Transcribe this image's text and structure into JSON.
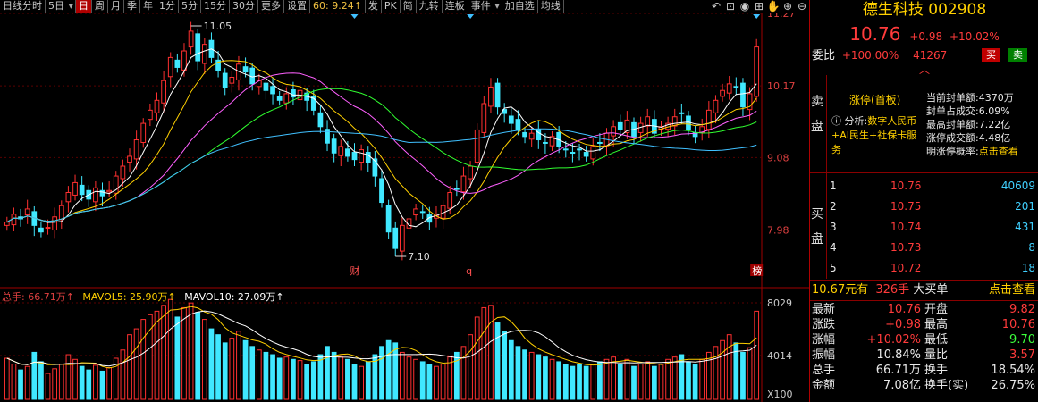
{
  "toolbar": {
    "items": [
      {
        "label": "日线分时",
        "dd": false
      },
      {
        "label": "5日",
        "dd": true
      },
      {
        "label": "日",
        "active": true
      },
      {
        "label": "周"
      },
      {
        "label": "月"
      },
      {
        "label": "季"
      },
      {
        "label": "年"
      },
      {
        "label": "1分"
      },
      {
        "label": "5分"
      },
      {
        "label": "15分"
      },
      {
        "label": "30分"
      },
      {
        "label": "更多"
      },
      {
        "label": "设置"
      },
      {
        "label": "60: 9.24↑",
        "hl": true
      },
      {
        "label": "发"
      },
      {
        "label": "PK"
      },
      {
        "label": "简"
      },
      {
        "label": "九转"
      },
      {
        "label": "连板"
      },
      {
        "label": "事件",
        "dd": true
      },
      {
        "label": "加自选"
      },
      {
        "label": "均线"
      }
    ],
    "icons": [
      "undo-icon",
      "lock-icon",
      "eye-icon",
      "bag-icon",
      "hand-icon",
      "zoom-in-icon",
      "zoom-out-icon"
    ]
  },
  "stock": {
    "name": "德生科技",
    "code": "002908",
    "price": "10.76",
    "change": "+0.98",
    "pct": "+10.02%",
    "weibi_label": "委比",
    "weibi": "+100.00%",
    "weicha": "41267",
    "buy_btn": "买",
    "sell_btn": "卖",
    "sell_side_label": "卖盘",
    "buy_side_label": "买盘"
  },
  "limit": {
    "title": "涨停(首板)",
    "analysis_label": "分析:",
    "analysis_text": "数字人民币+AI民生+社保卡服务",
    "stats": [
      {
        "k": "当前封单额:",
        "v": "4370万"
      },
      {
        "k": "封单占成交:",
        "v": "6.09%"
      },
      {
        "k": "最高封单额:",
        "v": "7.22亿"
      },
      {
        "k": "涨停成交额:",
        "v": "4.48亿"
      },
      {
        "k": "明涨停概率:",
        "v": "点击查看"
      }
    ]
  },
  "orderbook": {
    "bids": [
      {
        "lvl": "1",
        "price": "10.76",
        "vol": "40609"
      },
      {
        "lvl": "2",
        "price": "10.75",
        "vol": "201"
      },
      {
        "lvl": "3",
        "price": "10.74",
        "vol": "431"
      },
      {
        "lvl": "4",
        "price": "10.73",
        "vol": "8"
      },
      {
        "lvl": "5",
        "price": "10.72",
        "vol": "18"
      }
    ]
  },
  "bigbuy": {
    "price": "10.67元有",
    "vol": "326手",
    "label": "大买单",
    "link": "点击查看"
  },
  "quote": [
    {
      "k1": "最新",
      "v1": "10.76",
      "c1": "red",
      "k2": "开盘",
      "v2": "9.82",
      "c2": "red"
    },
    {
      "k1": "涨跌",
      "v1": "+0.98",
      "c1": "red",
      "k2": "最高",
      "v2": "10.76",
      "c2": "red"
    },
    {
      "k1": "涨幅",
      "v1": "+10.02%",
      "c1": "red",
      "k2": "最低",
      "v2": "9.70",
      "c2": "green"
    },
    {
      "k1": "振幅",
      "v1": "10.84%",
      "c1": "white",
      "k2": "量比",
      "v2": "3.57",
      "c2": "red"
    },
    {
      "k1": "总手",
      "v1": "66.71万",
      "c1": "white",
      "k2": "换手",
      "v2": "18.54%",
      "c2": "white"
    },
    {
      "k1": "金额",
      "v1": "7.08亿",
      "c1": "white",
      "k2": "换手(实)",
      "v2": "26.75%",
      "c2": "white"
    }
  ],
  "chart_data": {
    "type": "candlestick",
    "y_ticks": [
      "11.27",
      "10.17",
      "9.08",
      "7.98"
    ],
    "ylim": [
      7.2,
      11.27
    ],
    "high_label": "11.05",
    "low_label": "7.10",
    "markers": [
      "财",
      "q",
      "榜"
    ],
    "volume_ticks": [
      "8029",
      "4014",
      "X100"
    ],
    "volume_legend": {
      "total": "总手: 66.71万↑",
      "ma5": "MAVOL5: 25.90万↑",
      "ma10": "MAVOL10: 27.09万↑"
    },
    "colors": {
      "up": "#ff3030",
      "down": "#40e8ff",
      "ma5": "#ffffff",
      "ma10": "#ffd000",
      "ma20": "#ff60ff",
      "ma30": "#30ff30",
      "ma60": "#40c0ff"
    },
    "closes": [
      8.1,
      8.22,
      8.15,
      8.3,
      8.05,
      7.95,
      8.02,
      8.18,
      8.35,
      8.55,
      8.7,
      8.52,
      8.45,
      8.62,
      8.5,
      8.58,
      8.8,
      8.95,
      9.1,
      9.35,
      9.6,
      9.8,
      9.95,
      10.25,
      10.6,
      10.45,
      10.7,
      11.0,
      10.55,
      10.8,
      10.6,
      10.4,
      10.15,
      10.3,
      10.5,
      10.38,
      10.2,
      10.25,
      10.1,
      10.05,
      9.95,
      10.05,
      10.0,
      10.1,
      9.95,
      9.8,
      9.55,
      9.3,
      9.15,
      9.25,
      9.1,
      9.05,
      9.2,
      9.0,
      8.8,
      8.4,
      7.95,
      7.7,
      8.05,
      8.15,
      8.3,
      8.25,
      8.1,
      8.2,
      8.35,
      8.55,
      8.6,
      8.8,
      8.95,
      9.5,
      9.9,
      10.15,
      9.85,
      9.75,
      9.6,
      9.5,
      9.4,
      9.45,
      9.35,
      9.3,
      9.4,
      9.25,
      9.2,
      9.15,
      9.2,
      9.1,
      9.25,
      9.3,
      9.45,
      9.55,
      9.5,
      9.65,
      9.4,
      9.6,
      9.7,
      9.45,
      9.55,
      9.6,
      9.7,
      9.75,
      9.5,
      9.4,
      9.55,
      9.8,
      9.95,
      10.1,
      10.2,
      10.15,
      9.85,
      10.05,
      10.76
    ],
    "volumes": [
      35,
      30,
      25,
      28,
      40,
      32,
      22,
      26,
      30,
      38,
      34,
      28,
      25,
      29,
      24,
      27,
      35,
      42,
      55,
      60,
      68,
      72,
      75,
      80,
      85,
      70,
      78,
      82,
      74,
      68,
      60,
      55,
      48,
      52,
      58,
      50,
      45,
      42,
      40,
      38,
      35,
      36,
      34,
      33,
      30,
      32,
      38,
      45,
      40,
      36,
      34,
      30,
      28,
      32,
      38,
      45,
      50,
      48,
      40,
      36,
      34,
      32,
      30,
      28,
      30,
      36,
      40,
      45,
      55,
      70,
      78,
      80,
      65,
      58,
      50,
      45,
      42,
      40,
      38,
      36,
      34,
      32,
      30,
      28,
      30,
      28,
      30,
      32,
      34,
      36,
      30,
      34,
      28,
      30,
      32,
      28,
      30,
      34,
      36,
      38,
      32,
      30,
      34,
      40,
      45,
      50,
      55,
      48,
      40,
      44,
      75
    ]
  }
}
